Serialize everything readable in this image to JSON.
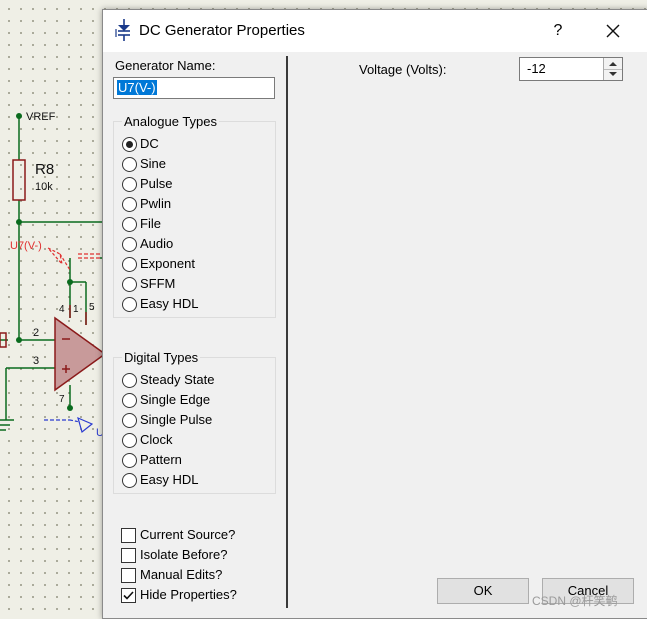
{
  "schematic": {
    "net_label_vref": "VREF",
    "resistor_name": "R8",
    "resistor_value": "10k",
    "generator_label": "U7(V-)",
    "pin_4": "4",
    "pin_1": "1",
    "pin_5": "5",
    "pin_2": "2",
    "pin_3": "3",
    "pin_7": "7",
    "partial_label": "U"
  },
  "dialog": {
    "title": "DC Generator Properties",
    "help_label": "?",
    "generator_name_label": "Generator Name:",
    "generator_name_value": "U7(V-)",
    "analogue_types": {
      "title": "Analogue Types",
      "options": [
        "DC",
        "Sine",
        "Pulse",
        "Pwlin",
        "File",
        "Audio",
        "Exponent",
        "SFFM",
        "Easy HDL"
      ],
      "selected": "DC"
    },
    "digital_types": {
      "title": "Digital Types",
      "options": [
        "Steady State",
        "Single Edge",
        "Single Pulse",
        "Clock",
        "Pattern",
        "Easy HDL"
      ]
    },
    "checkboxes": [
      {
        "label": "Current Source?",
        "checked": false
      },
      {
        "label": "Isolate Before?",
        "checked": false
      },
      {
        "label": "Manual Edits?",
        "checked": false
      },
      {
        "label": "Hide Properties?",
        "checked": true
      }
    ],
    "voltage_label": "Voltage (Volts):",
    "voltage_value": "-12",
    "ok_label": "OK",
    "cancel_label": "Cancel"
  },
  "watermark": "CSDN @杆笑鹌"
}
